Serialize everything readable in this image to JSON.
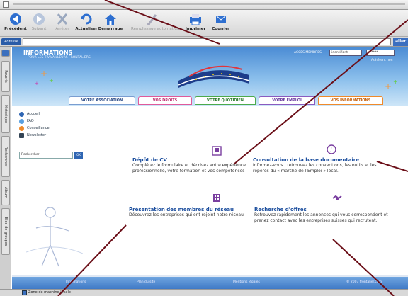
{
  "colors": {
    "accent_blue": "#1d4f9e",
    "banner_blue": "#4a8bd4",
    "pointer_line": "#6b0f18",
    "tab_assoc": "#7a9dd0",
    "tab_droits": "#e05a9a",
    "tab_quotidien": "#4caa4c",
    "tab_emploi": "#8a5bbf",
    "tab_info": "#f08a2a"
  },
  "toolbar": {
    "buttons": [
      {
        "label": "Précédent",
        "icon": "back-arrow-icon",
        "enabled": true
      },
      {
        "label": "Suivant",
        "icon": "forward-arrow-icon",
        "enabled": false
      },
      {
        "label": "Arrêter",
        "icon": "stop-x-icon",
        "enabled": false
      },
      {
        "label": "Actualiser",
        "icon": "refresh-icon",
        "enabled": true
      },
      {
        "label": "Démarrage",
        "icon": "home-icon",
        "enabled": true
      },
      {
        "label": "Remplissage automatique",
        "icon": "autofill-icon",
        "enabled": false
      },
      {
        "label": "Imprimer",
        "icon": "print-icon",
        "enabled": true
      },
      {
        "label": "Courrier",
        "icon": "mail-icon",
        "enabled": true
      }
    ]
  },
  "address_bar": {
    "label": "Adresse",
    "value": "",
    "go_label": "aller"
  },
  "side_tabs": [
    "Favoris",
    "Historique",
    "Rechercher",
    "Album",
    "Bloc-de-groupes"
  ],
  "banner": {
    "title": "INFORMATIONS",
    "subtitle": "POUR LES TRAVAILLEURS FRONTALIERS",
    "login_label": "ACCES MEMBRES",
    "login_user": "identifiant",
    "login_pass": "******",
    "login_link": "Adhérent non"
  },
  "nav_tabs": [
    {
      "label": "VOTRE ASSOCIATION"
    },
    {
      "label": "VOS DROITS"
    },
    {
      "label": "VOTRE QUOTIDIEN"
    },
    {
      "label": "VOTRE EMPLOI"
    },
    {
      "label": "VOS INFORMATIONS"
    }
  ],
  "menu": {
    "items": [
      {
        "label": "Accueil",
        "icon": "home-icon"
      },
      {
        "label": "FAQ",
        "icon": "faq-icon"
      },
      {
        "label": "Conseillance",
        "icon": "advice-icon"
      },
      {
        "label": "Newsletter",
        "icon": "newsletter-icon"
      }
    ],
    "search_placeholder": "Rechercher",
    "search_button": "OK"
  },
  "blocks": {
    "cv": {
      "title": "Dépôt de CV",
      "text": "Complétez le formulaire et décrivez votre expérience professionnelle, votre formation et vos compétences"
    },
    "docs": {
      "title": "Consultation de la base documentaire",
      "text": "Informez-vous ; retrouvez les conventions, les outils et les repères du « marché de l'Emploi » local."
    },
    "members": {
      "title": "Présentation des membres du réseau",
      "text": "Découvrez les entreprises qui ont rejoint notre réseau"
    },
    "offers": {
      "title": "Recherche d'offres",
      "text": "Retrouvez rapidement les annonces qui vous correspondent et prenez contact avec les entreprises suisses qui recrutent."
    }
  },
  "footer": {
    "links": [
      "Informations",
      "Plan du site",
      "Mentions légales",
      "© 2007 frontalier.com"
    ]
  },
  "status_bar": {
    "text": "Zone de machine locale"
  }
}
